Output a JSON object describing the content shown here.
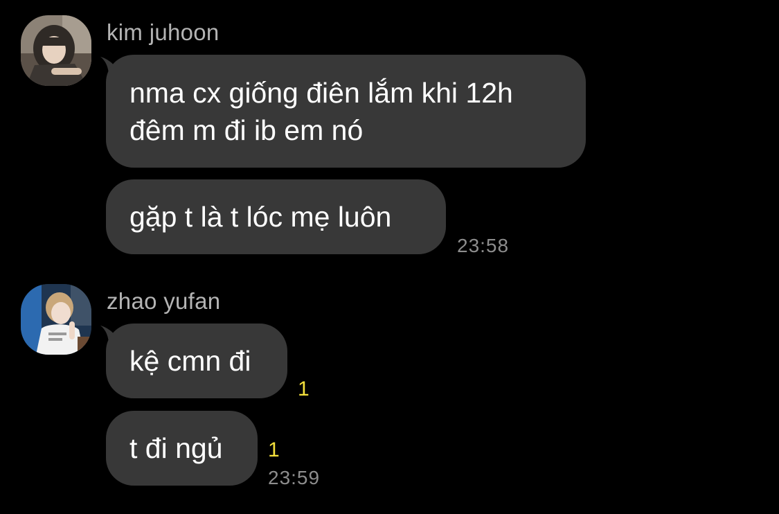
{
  "conversation": {
    "groups": [
      {
        "sender": "kim juhoon",
        "messages": [
          {
            "line1": "nma cx giống điên lắm khi 12h",
            "line2": "đêm m đi ib em nó"
          },
          {
            "text": "gặp t là t lóc mẹ luôn",
            "time": "23:58"
          }
        ]
      },
      {
        "sender": "zhao yufan",
        "messages": [
          {
            "text": "kệ cmn đi",
            "unread": "1"
          },
          {
            "text": "t đi ngủ",
            "unread": "1",
            "time": "23:59"
          }
        ]
      }
    ]
  },
  "colors": {
    "background": "#000000",
    "bubble": "#383838",
    "sender_name": "#b4b4b4",
    "timestamp": "#8d8d8d",
    "unread_count": "#f5e13c"
  },
  "icons": {
    "avatar_1": "profile-photo-kim-juhoon",
    "avatar_2": "profile-photo-zhao-yufan"
  }
}
